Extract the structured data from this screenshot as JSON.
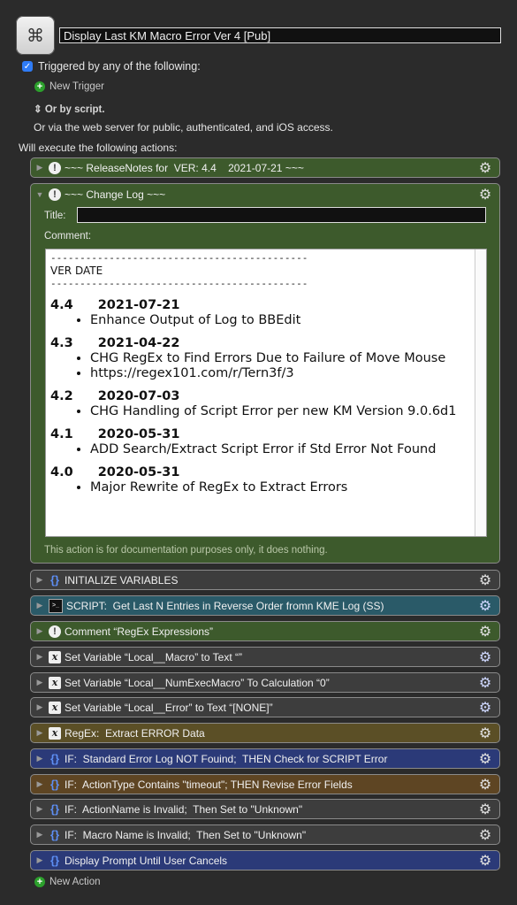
{
  "macro": {
    "title": "Display Last KM Macro Error Ver 4 [Pub]"
  },
  "triggers": {
    "label": "Triggered by any of the following:",
    "new_trigger": "New Trigger",
    "or_script": "Or by script.",
    "web": "Or via the web server for public, authenticated, and iOS access.",
    "will_execute": "Will execute the following actions:"
  },
  "actions": [
    {
      "label": "~~~ ReleaseNotes for  VER: 4.4    2021-07-21 ~~~",
      "icon": "exclamation-icon",
      "color": "#3d5a2c"
    },
    {
      "label": "INITIALIZE VARIABLES",
      "icon": "braces-icon",
      "color": "#3d3d3d"
    },
    {
      "label": "SCRIPT:  Get Last N Entries in Reverse Order fromn KME Log (SS)",
      "icon": "terminal-icon",
      "color": "#2a5a68"
    },
    {
      "label": "Comment “RegEx Expressions”",
      "icon": "exclamation-icon",
      "color": "#3d5a2c"
    },
    {
      "label": "Set Variable “Local__Macro” to Text “”",
      "icon": "variable-icon",
      "color": "#3d3d3d"
    },
    {
      "label": "Set Variable “Local__NumExecMacro” To Calculation “0”",
      "icon": "variable-icon",
      "color": "#3d3d3d"
    },
    {
      "label": "Set Variable “Local__Error” to Text “[NONE]”",
      "icon": "variable-icon",
      "color": "#3d3d3d"
    },
    {
      "label": "RegEx:  Extract ERROR Data",
      "icon": "variable-icon",
      "color": "#5b4f26"
    },
    {
      "label": "IF:  Standard Error Log NOT Fouind;  THEN Check for SCRIPT Error",
      "icon": "braces-icon",
      "color": "#2b3a78"
    },
    {
      "label": "IF:  ActionType Contains \"timeout\"; THEN Revise Error Fields",
      "icon": "braces-icon",
      "color": "#5e4523"
    },
    {
      "label": "IF:  ActionName is Invalid;  Then Set to \"Unknown\"",
      "icon": "braces-icon",
      "color": "#3d3d3d"
    },
    {
      "label": "IF:  Macro Name is Invalid;  Then Set to \"Unknown\"",
      "icon": "braces-icon",
      "color": "#3d3d3d"
    },
    {
      "label": "Display Prompt Until User Cancels",
      "icon": "braces-icon",
      "color": "#2b3a78"
    }
  ],
  "changelog": {
    "header": "~~~ Change Log ~~~",
    "title_label": "Title:",
    "title_value": "",
    "comment_label": "Comment:",
    "dashes": "--------------------------------------------",
    "columns": "VER   DATE",
    "entries": [
      {
        "ver": "4.4",
        "date": "2021-07-21",
        "items": [
          "Enhance Output of Log to BBEdit"
        ]
      },
      {
        "ver": "4.3",
        "date": "2021-04-22",
        "items": [
          "CHG RegEx to Find Errors Due to Failure of Move Mouse",
          "https://regex101.com/r/Tern3f/3"
        ]
      },
      {
        "ver": "4.2",
        "date": "2020-07-03",
        "items": [
          "CHG Handling of Script Error per new KM Version 9.0.6d1"
        ]
      },
      {
        "ver": "4.1",
        "date": "2020-05-31",
        "items": [
          "ADD Search/Extract Script Error if Std Error Not Found"
        ]
      },
      {
        "ver": "4.0",
        "date": "2020-05-31",
        "items": [
          "Major Rewrite of RegEx to Extract Errors"
        ]
      }
    ],
    "doc_note": "This action is for documentation purposes only, it does nothing."
  },
  "footer": {
    "new_action": "New Action"
  }
}
